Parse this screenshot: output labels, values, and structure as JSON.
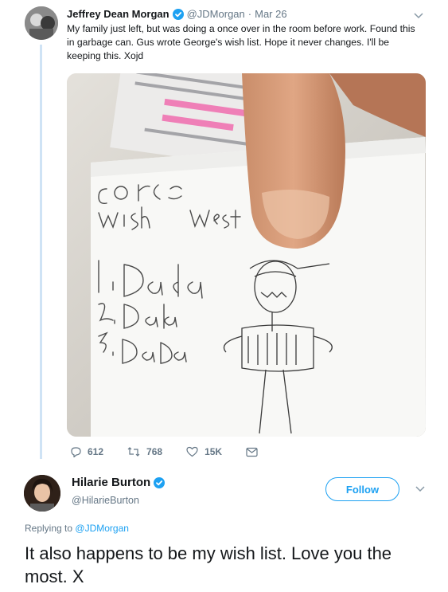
{
  "tweet1": {
    "author_name": "Jeffrey Dean Morgan",
    "handle": "@JDMorgan",
    "separator": "·",
    "date": "Mar 26",
    "text": "My family just left, but was doing a once over in the room before work. Found this in garbage can. Gus wrote George's wish list. Hope it never changes. I'll be keeping this. Xojd",
    "photo": {
      "line1": "Go",
      "line2": "wish",
      "line3": "West",
      "item1": "1.Dada",
      "item2": "2.Dada",
      "item3": "3.DaDa"
    },
    "stats": {
      "replies": "612",
      "retweets": "768",
      "likes": "15K"
    }
  },
  "tweet2": {
    "author_name": "Hilarie Burton",
    "handle": "@HilarieBurton",
    "follow_label": "Follow",
    "replying_prefix": "Replying to",
    "replying_to": "@JDMorgan",
    "text": "It also happens to be my wish list. Love you the most. X"
  },
  "colors": {
    "accent": "#1da1f2",
    "secondary_text": "#657786",
    "thread_line": "#cfe3f5"
  },
  "icons": [
    "verified-icon",
    "chevron-down-icon",
    "reply-icon",
    "retweet-icon",
    "like-icon",
    "message-icon"
  ]
}
